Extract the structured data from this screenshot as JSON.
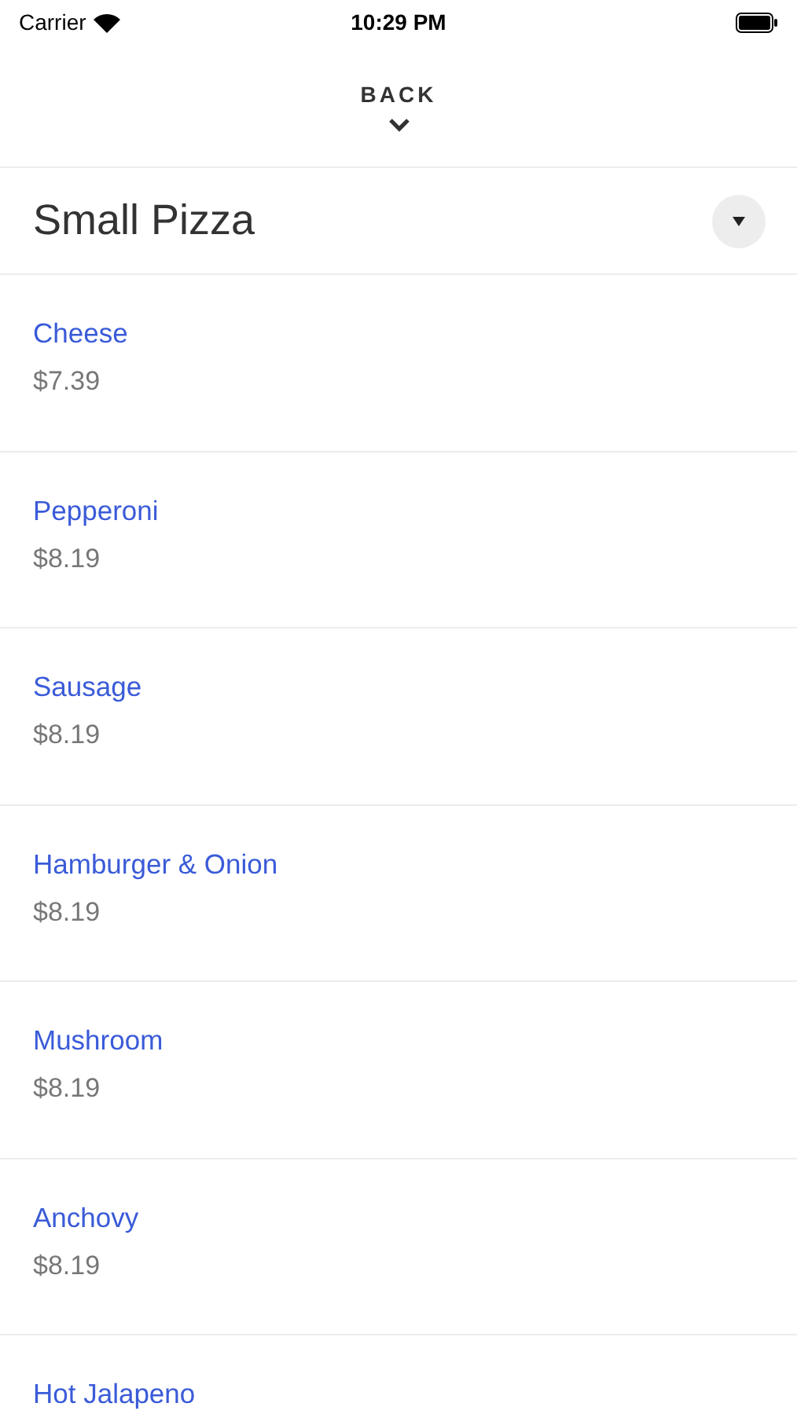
{
  "status_bar": {
    "carrier": "Carrier",
    "time": "10:29 PM"
  },
  "header": {
    "back_label": "BACK"
  },
  "title": "Small Pizza",
  "items": [
    {
      "name": "Cheese",
      "price": "$7.39"
    },
    {
      "name": "Pepperoni",
      "price": "$8.19"
    },
    {
      "name": "Sausage",
      "price": "$8.19"
    },
    {
      "name": "Hamburger & Onion",
      "price": "$8.19"
    },
    {
      "name": "Mushroom",
      "price": "$8.19"
    },
    {
      "name": "Anchovy",
      "price": "$8.19"
    },
    {
      "name": "Hot Jalapeno"
    }
  ]
}
